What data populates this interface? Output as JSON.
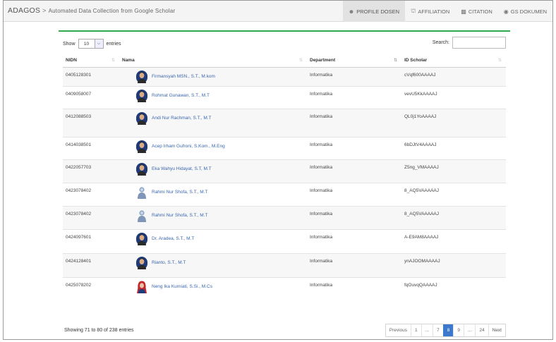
{
  "app": {
    "brand": "ADAGOS",
    "subtitle": "Automated Data Collection from Google Scholar"
  },
  "nav": {
    "items": [
      {
        "label": "PROFILE DOSEN",
        "icon": "users-icon",
        "active": true
      },
      {
        "label": "AFFILIATION",
        "icon": "institution-icon",
        "active": false
      },
      {
        "label": "CITATION",
        "icon": "bar-chart-icon",
        "active": false
      },
      {
        "label": "GS DOKUMEN",
        "icon": "globe-icon",
        "active": false
      }
    ]
  },
  "controls": {
    "show_label": "Show",
    "entries_value": "10",
    "entries_label": "entries",
    "search_label": "Search:",
    "search_value": ""
  },
  "table": {
    "headers": [
      "NIDN",
      "Nama",
      "Department",
      "ID Scholar"
    ],
    "rows": [
      {
        "nidn": "0405128301",
        "nama": "Firmansyah MSN., S.T., M.kom",
        "dept": "Informatika",
        "scholar": "cVqf600AAAAJ",
        "avatar": "person-avatar-icon"
      },
      {
        "nidn": "0409058007",
        "nama": "Rohmat Gunawan, S.T., M.T",
        "dept": "Informatika",
        "scholar": "vevU5KkAAAAJ",
        "avatar": "person-avatar-icon"
      },
      {
        "nidn": "0412088503",
        "nama": "Andi Nur Rachman, S.T., M.T",
        "dept": "Informatika",
        "scholar": "QL0j1YoAAAAJ",
        "avatar": "person-avatar-icon"
      },
      {
        "nidn": "0414038501",
        "nama": "Acep Irham Gufroni, S.Kom., M.Eng",
        "dept": "Informatika",
        "scholar": "6bDJtV4AAAAJ",
        "avatar": "person-avatar-icon"
      },
      {
        "nidn": "0422057703",
        "nama": "Eka Wahyu Hidayat, S.T, M.T",
        "dept": "Informatika",
        "scholar": "Z5ng_VMAAAAJ",
        "avatar": "person-avatar-icon"
      },
      {
        "nidn": "0423078402",
        "nama": "Rahmi Nur Shofa, S.T., M.T",
        "dept": "Informatika",
        "scholar": "8_AQ5VAAAAAJ",
        "avatar": "default-avatar-icon"
      },
      {
        "nidn": "0423078402",
        "nama": "Rahmi Nur Shofa, S.T., M.T",
        "dept": "Informatika",
        "scholar": "8_AQ5VAAAAAJ",
        "avatar": "default-avatar-icon"
      },
      {
        "nidn": "0424097601",
        "nama": "Dr. Aradea, S.T., M.T",
        "dept": "Informatika",
        "scholar": "A-E9AM8AAAAJ",
        "avatar": "person-avatar-icon"
      },
      {
        "nidn": "0424128401",
        "nama": "Rianto, S.T., M.T",
        "dept": "Informatika",
        "scholar": "ynAJOOMAAAAJ",
        "avatar": "person-avatar-icon"
      },
      {
        "nidn": "0425078202",
        "nama": "Neng Ika Kurniati, S.Si., M.Cs",
        "dept": "Informatika",
        "scholar": "fqOuvqQAAAAJ",
        "avatar": "hijab-avatar-icon"
      }
    ]
  },
  "footer": {
    "info": "Showing 71 to 80 of 238 entries",
    "pages": [
      "Previous",
      "1",
      "...",
      "7",
      "8",
      "9",
      "...",
      "24",
      "Next"
    ],
    "current_page": "8"
  },
  "colors": {
    "accent_green": "#2fa84f",
    "link_blue": "#3a66b0",
    "pager_active": "#3c79cc"
  }
}
